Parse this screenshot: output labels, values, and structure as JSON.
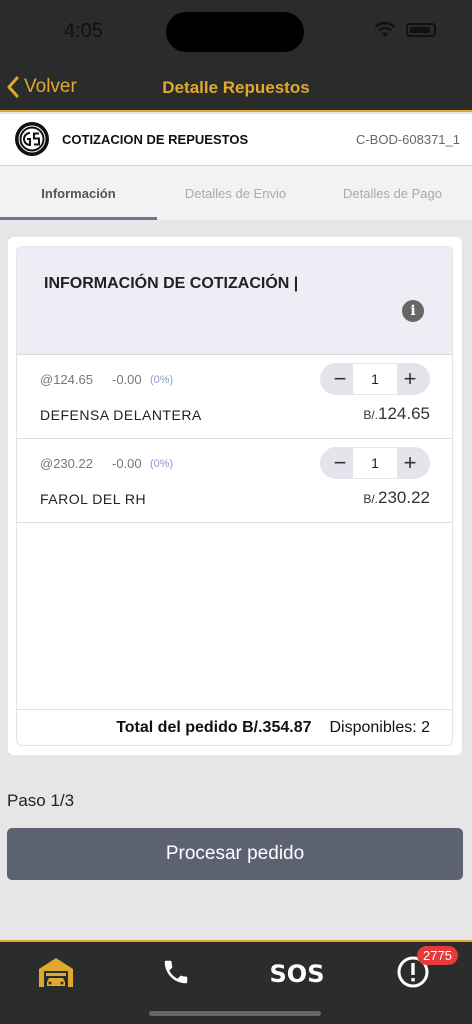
{
  "status": {
    "time": "4:05"
  },
  "nav": {
    "back_label": "Volver",
    "title": "Detalle Repuestos"
  },
  "header": {
    "title": "COTIZACION DE REPUESTOS",
    "code": "C-BOD-608371_1"
  },
  "tabs": [
    {
      "label": "Información",
      "active": true
    },
    {
      "label": "Detalles de Envio",
      "active": false
    },
    {
      "label": "Detalles de Pago",
      "active": false
    }
  ],
  "section": {
    "title": "INFORMACIÓN DE COTIZACIÓN |"
  },
  "items": [
    {
      "unit_price": "@124.65",
      "discount": "-0.00",
      "discount_pct": "(0%)",
      "qty": "1",
      "name": "DEFENSA DELANTERA",
      "currency": "B/.",
      "total": "124.65"
    },
    {
      "unit_price": "@230.22",
      "discount": "-0.00",
      "discount_pct": "(0%)",
      "qty": "1",
      "name": "FAROL DEL RH",
      "currency": "B/.",
      "total": "230.22"
    }
  ],
  "footer": {
    "total": "Total del pedido B/.354.87",
    "available": "Disponibles: 2"
  },
  "step": "Paso 1/3",
  "process_button": "Procesar pedido",
  "bottom_nav": {
    "sos_label": "SOS",
    "badge_count": "2775"
  },
  "colors": {
    "accent": "#e0a82e",
    "dark": "#2a2c2c",
    "button": "#5c6272"
  }
}
